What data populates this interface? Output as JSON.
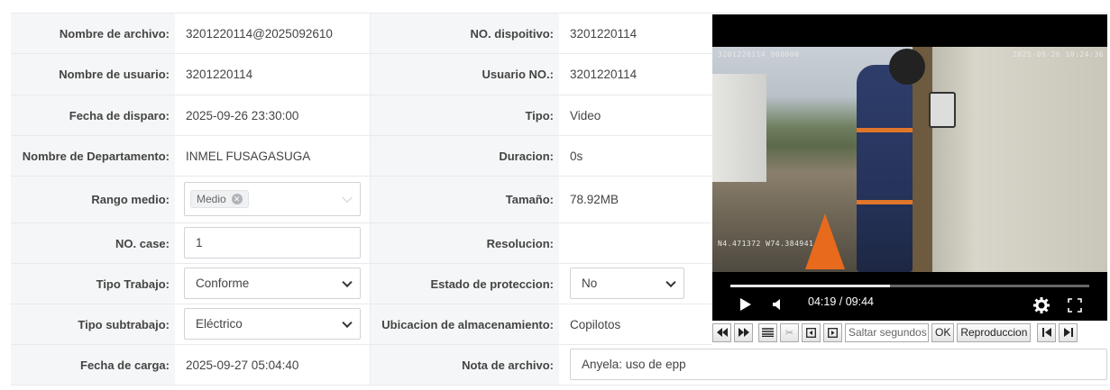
{
  "rows": {
    "file_name": {
      "label": "Nombre de archivo:",
      "value": "3201220114@2025092610"
    },
    "device_no": {
      "label": "NO. dispoitivo:",
      "value": "3201220114"
    },
    "user_name": {
      "label": "Nombre de usuario:",
      "value": "3201220114"
    },
    "user_no": {
      "label": "Usuario NO.:",
      "value": "3201220114"
    },
    "trigger_date": {
      "label": "Fecha de disparo:",
      "value": "2025-09-26 23:30:00"
    },
    "type": {
      "label": "Tipo:",
      "value": "Video"
    },
    "department": {
      "label": "Nombre de Departamento:",
      "value": "INMEL FUSAGASUGA"
    },
    "duration": {
      "label": "Duracion:",
      "value": "0s"
    },
    "media_range": {
      "label": "Rango medio:",
      "tag": "Medio"
    },
    "size": {
      "label": "Tamaño:",
      "value": "78.92MB"
    },
    "case_no": {
      "label": "NO. case:",
      "value": "1"
    },
    "resolution": {
      "label": "Resolucion:",
      "value": ""
    },
    "work_type": {
      "label": "Tipo Trabajo:",
      "value": "Conforme"
    },
    "protection_state": {
      "label": "Estado de proteccion:",
      "value": "No"
    },
    "work_subtype": {
      "label": "Tipo subtrabajo:",
      "value": "Eléctrico"
    },
    "storage_location": {
      "label": "Ubicacion de almacenamiento:",
      "value": "Copilotos"
    },
    "upload_date": {
      "label": "Fecha de carga:",
      "value": "2025-09-27 05:04:40"
    },
    "file_note": {
      "label": "Nota de archivo:",
      "value": "Anyela: uso de epp"
    }
  },
  "video": {
    "osd_id": "3201220114_000000",
    "osd_datetime": "2025-09-26  10:24:36",
    "osd_gps": "N4.471372  W74.384941",
    "current_time": "04:19",
    "total_time": "09:44",
    "time_display": "04:19 / 09:44",
    "progress": 0.4435
  },
  "toolbar": {
    "skip_placeholder": "Saltar segundos",
    "ok_label": "OK",
    "playback_label": "Reproduccion"
  },
  "colors": {
    "label_bg": "#f5f6f7",
    "border": "#e8eaed",
    "video_bg": "#000000"
  }
}
